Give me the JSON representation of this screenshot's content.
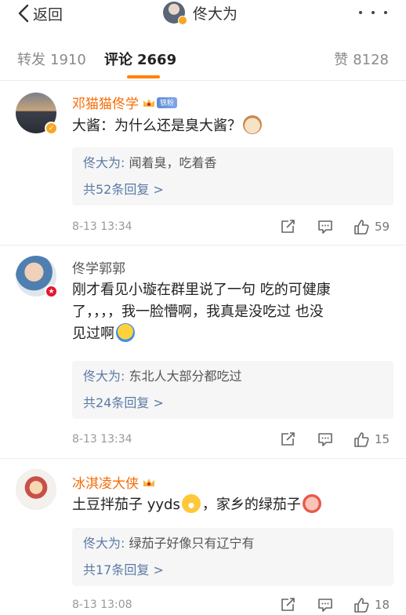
{
  "header": {
    "back_label": "返回",
    "title": "佟大为"
  },
  "tabs": {
    "repost": {
      "label": "转发",
      "count": "1910"
    },
    "comment": {
      "label": "评论",
      "count": "2669"
    },
    "like": {
      "label": "赞",
      "count": "8128"
    }
  },
  "comments": [
    {
      "username": "邓猫猫佟学",
      "fan_badge": "铁粉",
      "text": "大酱：为什么还是臭大酱？",
      "reply_author": "佟大为:",
      "reply_text": "闻着臭，吃着香",
      "reply_count_text": "共52条回复 >",
      "time": "8-13 13:34",
      "likes": "59"
    },
    {
      "username": "佟学郭郭",
      "text_line1": "刚才看见小璇在群里说了一句 吃的可健康",
      "text_line2": "了，，，，我一脸懵啊，我真是没吃过 也没",
      "text_line3": "见过啊",
      "reply_author": "佟大为:",
      "reply_text": "东北人大部分都吃过",
      "reply_count_text": "共24条回复 >",
      "time": "8-13 13:34",
      "likes": "15"
    },
    {
      "username": "冰淇凌大侠",
      "text_part1": "土豆拌茄子 yyds",
      "text_part2": "，家乡的绿茄子",
      "reply_author": "佟大为:",
      "reply_text": "绿茄子好像只有辽宁有",
      "reply_count_text": "共17条回复 >",
      "time": "8-13 13:08",
      "likes": "18"
    }
  ],
  "colors": {
    "accent": "#ff8200",
    "username_highlight": "#f86b06",
    "link_blue": "#5a7aa6",
    "vip_gold": "#f8a623"
  }
}
